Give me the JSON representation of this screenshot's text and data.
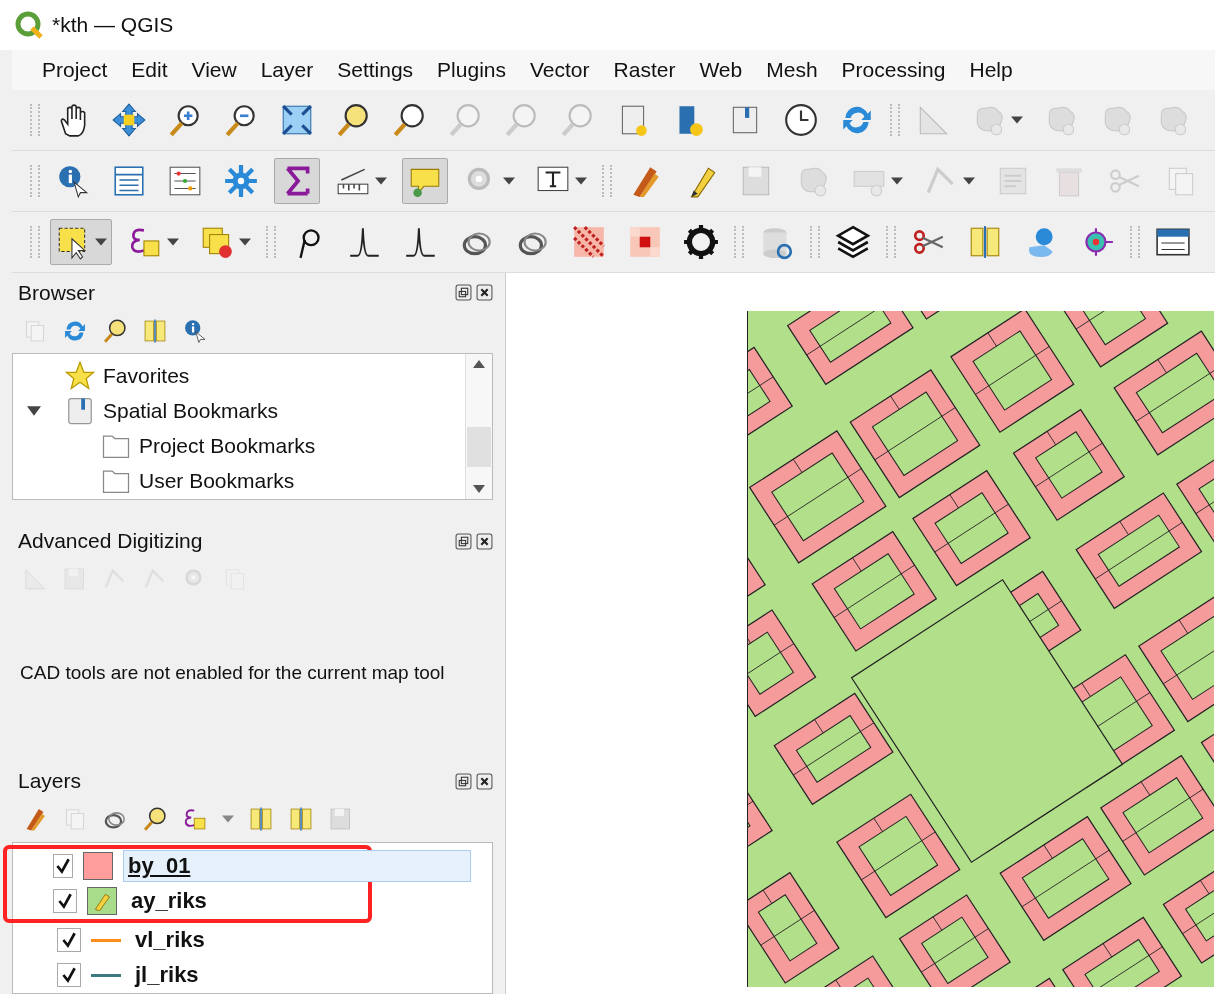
{
  "window": {
    "title": "*kth — QGIS"
  },
  "menu": [
    {
      "label": "Project"
    },
    {
      "label": "Edit"
    },
    {
      "label": "View"
    },
    {
      "label": "Layer"
    },
    {
      "label": "Settings"
    },
    {
      "label": "Plugins"
    },
    {
      "label": "Vector"
    },
    {
      "label": "Raster"
    },
    {
      "label": "Web"
    },
    {
      "label": "Mesh"
    },
    {
      "label": "Processing"
    },
    {
      "label": "Help"
    }
  ],
  "browser": {
    "title": "Browser",
    "tree": [
      {
        "label": "Favorites",
        "kind": "star"
      },
      {
        "label": "Spatial Bookmarks",
        "kind": "bookmarks",
        "expanded": true,
        "children": [
          {
            "label": "Project Bookmarks",
            "kind": "folder"
          },
          {
            "label": "User Bookmarks",
            "kind": "folder"
          }
        ]
      }
    ]
  },
  "advanced_digitizing": {
    "title": "Advanced Digitizing",
    "message": "CAD tools are not enabled for the current map tool"
  },
  "layers": {
    "title": "Layers",
    "items": [
      {
        "name": "by_01",
        "kind": "fill",
        "color": "#ff9d9d",
        "checked": true,
        "selected": true,
        "highlighted": true
      },
      {
        "name": "ay_riks",
        "kind": "edit",
        "color": "#a9dc8a",
        "checked": true,
        "selected": false,
        "highlighted": true
      },
      {
        "name": "vl_riks",
        "kind": "line",
        "color": "#ff8c1a",
        "checked": true,
        "selected": false,
        "highlighted": false
      },
      {
        "name": "jl_riks",
        "kind": "line",
        "color": "#3d7a80",
        "checked": true,
        "selected": false,
        "highlighted": false
      }
    ]
  }
}
